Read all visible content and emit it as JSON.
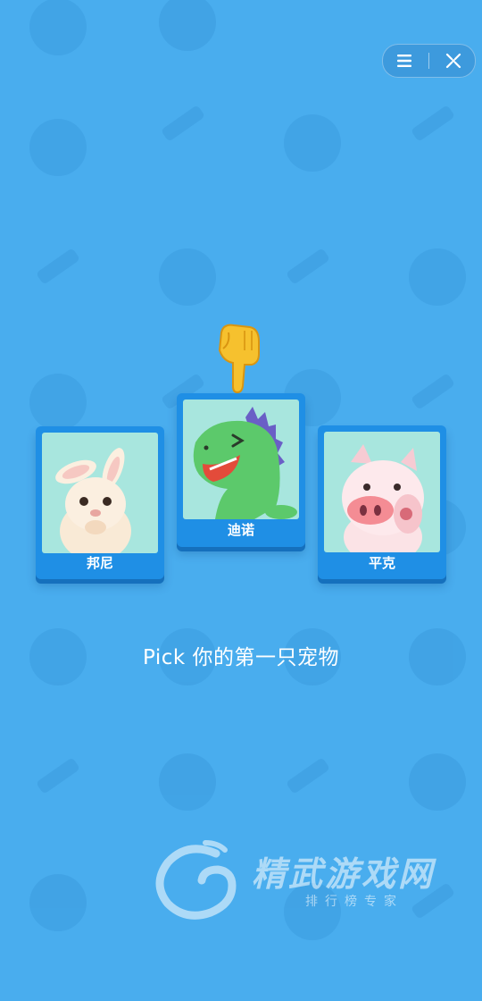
{
  "window": {
    "menu_icon": "menu-icon",
    "close_icon": "close-target-icon"
  },
  "pets": [
    {
      "label": "邦尼",
      "animal": "bunny"
    },
    {
      "label": "迪诺",
      "animal": "dinosaur",
      "selected": true
    },
    {
      "label": "平克",
      "animal": "pig"
    }
  ],
  "prompt": "Pick 你的第一只宠物",
  "watermark": {
    "title": "精武游戏网",
    "subtitle": "排行榜专家"
  },
  "colors": {
    "background": "#49adee",
    "card": "#1f8fe5",
    "card_art_bg": "#a8e6de"
  }
}
